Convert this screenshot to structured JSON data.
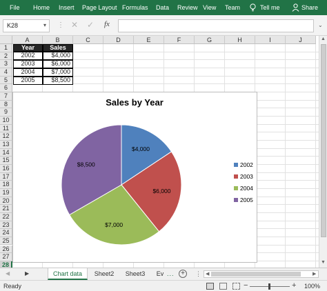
{
  "ribbon": {
    "tabs": [
      "File",
      "Home",
      "Insert",
      "Page Layout",
      "Formulas",
      "Data",
      "Review",
      "View",
      "Team"
    ],
    "tell_me": "Tell me",
    "share": "Share",
    "bar_color": "#217346"
  },
  "formula_bar": {
    "name_box": "K28",
    "cancel_icon": "cancel-icon",
    "enter_icon": "enter-icon",
    "fx_label": "fx",
    "formula": ""
  },
  "grid": {
    "columns": [
      "A",
      "B",
      "C",
      "D",
      "E",
      "F",
      "G",
      "H",
      "I",
      "J"
    ],
    "rows": [
      "1",
      "2",
      "3",
      "4",
      "5",
      "6",
      "7",
      "8",
      "9",
      "10",
      "11",
      "12",
      "13",
      "14",
      "15",
      "16",
      "17",
      "18",
      "19",
      "20",
      "21",
      "22",
      "23",
      "24",
      "25",
      "26",
      "27",
      "28"
    ],
    "active_row": "28",
    "table": {
      "headers": [
        "Year",
        "Sales"
      ],
      "rows": [
        [
          "2002",
          "$4,000"
        ],
        [
          "2003",
          "$6,000"
        ],
        [
          "2004",
          "$7,000"
        ],
        [
          "2005",
          "$8,500"
        ]
      ]
    }
  },
  "chart_data": {
    "type": "pie",
    "title": "Sales by Year",
    "categories": [
      "2002",
      "2003",
      "2004",
      "2005"
    ],
    "values": [
      4000,
      6000,
      7000,
      8500
    ],
    "data_labels": [
      "$4,000",
      "$6,000",
      "$7,000",
      "$8,500"
    ],
    "colors": [
      "#4F81BD",
      "#C0504D",
      "#9BBB59",
      "#8064A2"
    ],
    "legend_position": "right"
  },
  "sheet_tabs": {
    "tabs": [
      "Chart data",
      "Sheet2",
      "Sheet3",
      "Ev"
    ],
    "active": "Chart data",
    "more": "..."
  },
  "status_bar": {
    "ready": "Ready",
    "zoom": "100%",
    "zoom_fraction": 0.5
  }
}
